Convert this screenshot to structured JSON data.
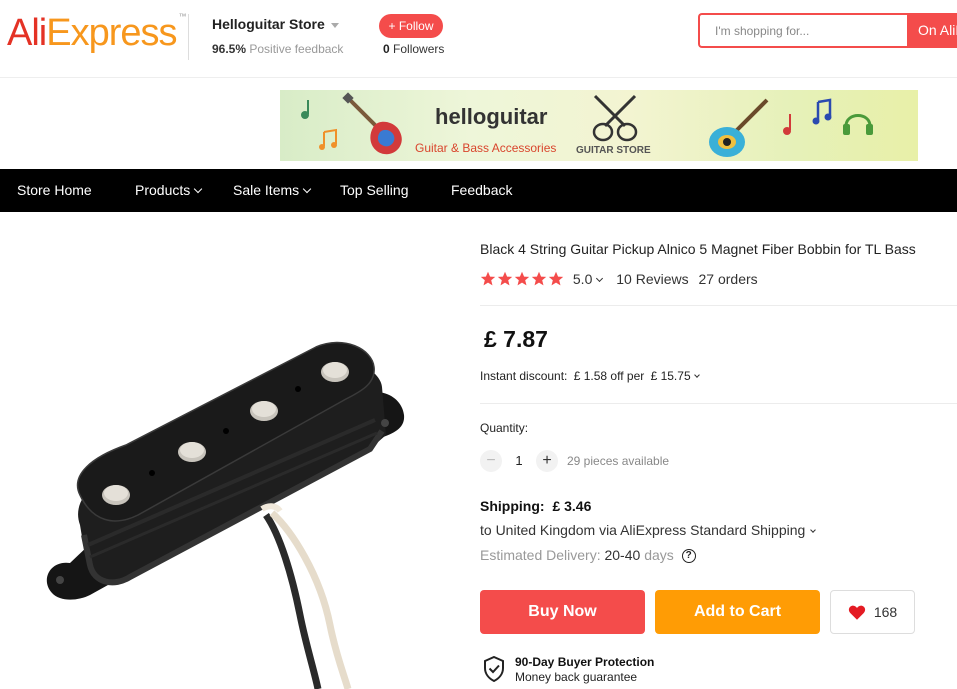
{
  "header": {
    "logo_ali": "Ali",
    "logo_express": "Express",
    "logo_tm": "™",
    "store_name": "Helloguitar Store",
    "feedback_pct": "96.5%",
    "feedback_label": "Positive feedback",
    "follow_label": "+ Follow",
    "followers_count": "0",
    "followers_label": "Followers",
    "search_placeholder": "I'm shopping for...",
    "search_scope": "On AliExpress"
  },
  "banner": {
    "title": "helloguitar",
    "subtitle": "Guitar & Bass Accessories",
    "store_label": "GUITAR STORE"
  },
  "nav": {
    "items": [
      {
        "label": "Store Home",
        "dropdown": false
      },
      {
        "label": "Products",
        "dropdown": true
      },
      {
        "label": "Sale Items",
        "dropdown": true
      },
      {
        "label": "Top Selling",
        "dropdown": false
      },
      {
        "label": "Feedback",
        "dropdown": false
      }
    ]
  },
  "product": {
    "title": "Black 4 String Guitar Pickup Alnico 5 Magnet Fiber Bobbin for TL Bass",
    "rating": "5.0",
    "stars": 5,
    "reviews": "10 Reviews",
    "orders": "27 orders",
    "price": "£ 7.87",
    "discount_label": "Instant discount:",
    "discount_value": "£ 1.58 off per",
    "discount_threshold": "£ 15.75",
    "quantity_label": "Quantity:",
    "quantity": "1",
    "availability": "29 pieces available",
    "shipping_label": "Shipping:",
    "shipping_price": "£ 3.46",
    "shipping_to": "to United Kingdom via AliExpress Standard Shipping",
    "estimated_label": "Estimated Delivery:",
    "estimated_range": "20-40",
    "estimated_unit": "days",
    "help": "?",
    "buy_now": "Buy Now",
    "add_to_cart": "Add to Cart",
    "wishlist_count": "168",
    "protection_title": "90-Day Buyer Protection",
    "protection_sub": "Money back guarantee"
  },
  "colors": {
    "accent_red": "#f44c4b",
    "cart_orange": "#ff9c05",
    "star_red": "#f44c4b",
    "nav_black": "#000000"
  }
}
